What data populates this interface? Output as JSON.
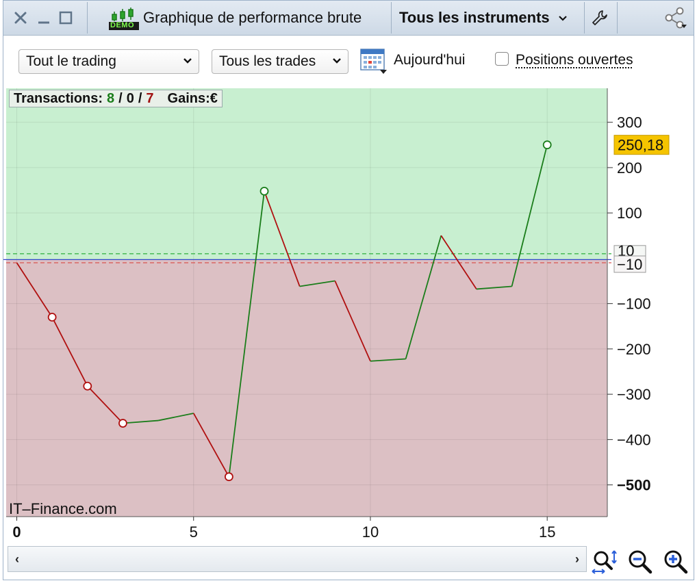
{
  "window": {
    "title": "Graphique de performance brute",
    "demo_badge": "DEMO",
    "instrument_selector": "Tous les instruments"
  },
  "toolbar": {
    "trading_filter": "Tout le trading",
    "trades_filter": "Tous les trades",
    "date_label": "Aujourd'hui",
    "open_positions_label": "Positions ouvertes",
    "open_positions_checked": false
  },
  "stats": {
    "transactions_label": "Transactions:",
    "wins": "8",
    "sep1": "/",
    "neutral": "0",
    "sep2": "/",
    "losses": "7",
    "gains_label": "Gains:",
    "currency": "€"
  },
  "chart_data": {
    "type": "line",
    "x": [
      0,
      1,
      2,
      3,
      4,
      5,
      6,
      7,
      8,
      9,
      10,
      11,
      12,
      13,
      14,
      15
    ],
    "y": [
      -10,
      -130,
      -282,
      -364,
      -358,
      -342,
      -482,
      148,
      -62,
      -50,
      -227,
      -222,
      50,
      -68,
      -62,
      250.18
    ],
    "trade_markers_x": [
      1,
      2,
      3,
      6,
      7,
      15
    ],
    "xlim": [
      -0.3,
      16.7
    ],
    "ylim": [
      -570,
      375
    ],
    "x_ticks": [
      0,
      5,
      10,
      15
    ],
    "x_tick_labels": [
      "0",
      "5",
      "10",
      "15"
    ],
    "y_ticks": [
      300,
      200,
      100,
      -100,
      -200,
      -300,
      -400,
      -500
    ],
    "y_tick_labels": [
      "300",
      "200",
      "100",
      "−100",
      "−200",
      "−300",
      "−400",
      "−500"
    ],
    "upper_threshold": 10,
    "upper_threshold_label": "10",
    "lower_threshold": -10,
    "lower_threshold_label": "−10",
    "baseline": -3,
    "last_value_label": "250,18",
    "rise_color": "#1a7d1a",
    "fall_color": "#b01010",
    "profit_zone_color": "#c8efd0",
    "loss_zone_color": "#dcc0c4",
    "grid": true,
    "watermark": "IT–Finance.com"
  },
  "colors": {
    "accent_value_badge": "#f5c400",
    "baseline_line": "#3344cc"
  },
  "icons": {
    "close": "close-icon",
    "minimize": "minimize-icon",
    "maximize": "maximize-icon",
    "demo_chart": "candlestick-demo-icon",
    "wrench": "wrench-icon",
    "share": "share-icon",
    "calendar": "calendar-icon",
    "zoom_fit": "zoom-fit-icon",
    "zoom_out": "zoom-out-icon",
    "zoom_in": "zoom-in-icon"
  }
}
